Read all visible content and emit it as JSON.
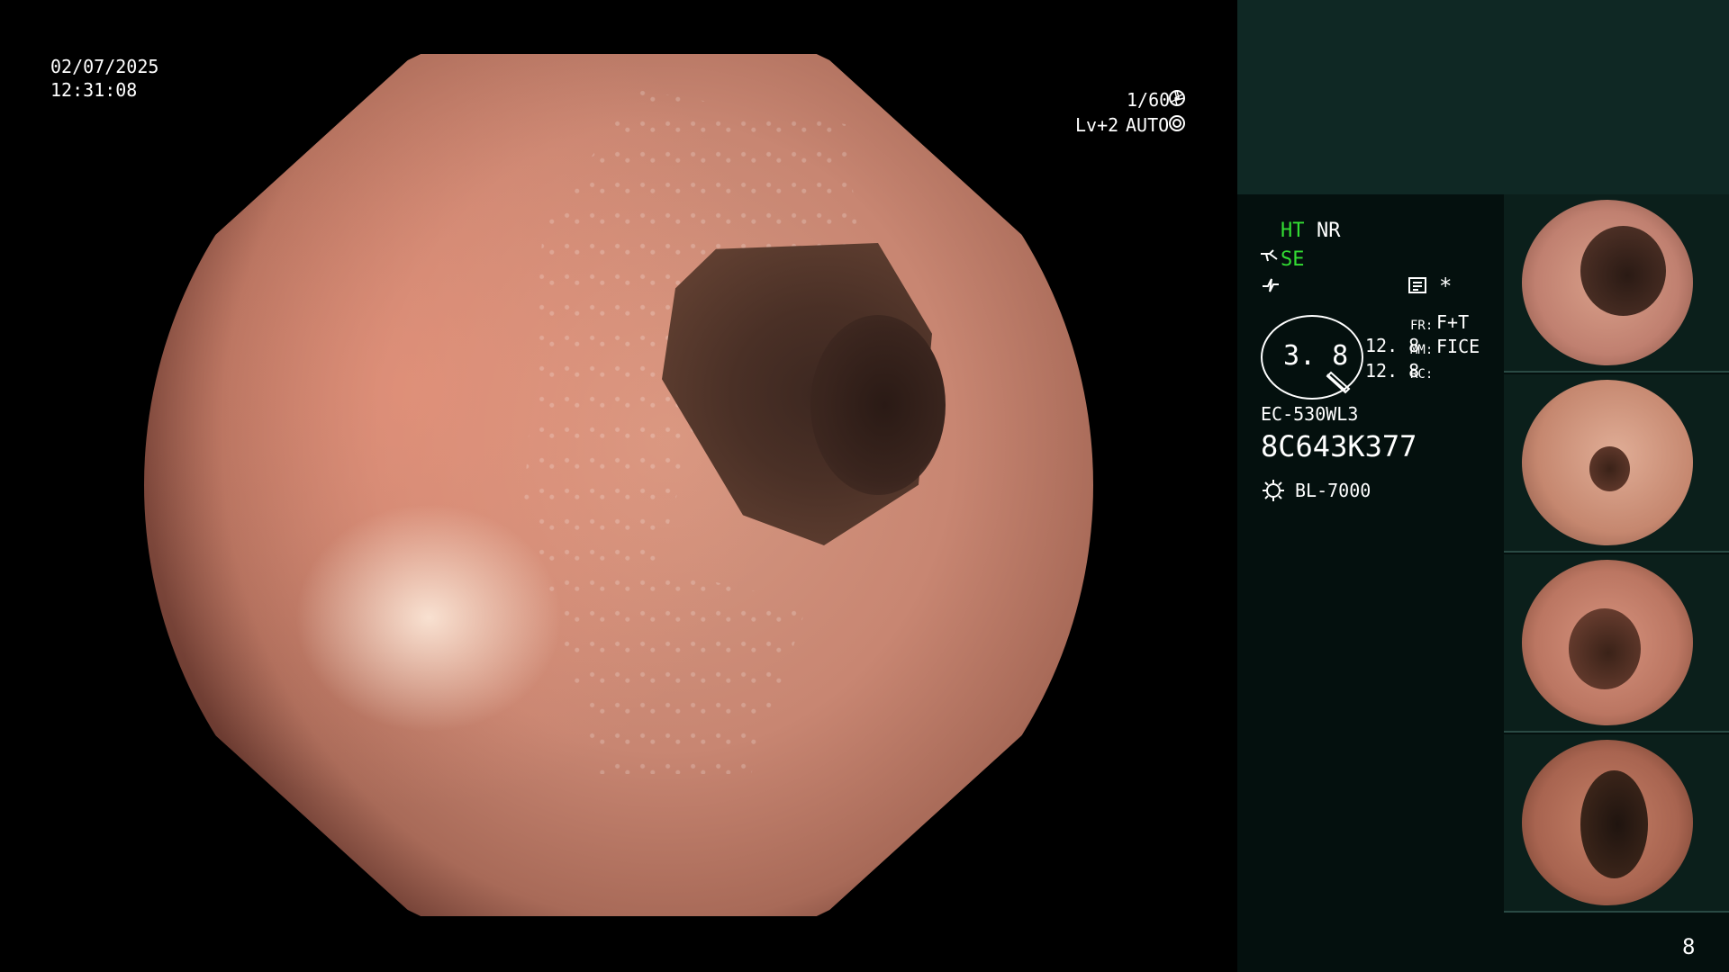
{
  "overlay": {
    "date": "02/07/2025",
    "time": "12:31:08",
    "shutter": "1/60",
    "level": "Lv+2",
    "mode": "AUTO"
  },
  "settings": {
    "ht": "HT",
    "nr": "NR",
    "se": "SE",
    "asterisk": "*",
    "zoom_value": "3. 8",
    "value_a": "12. 8",
    "value_b": "12. 8",
    "fr_label": "FR:",
    "fr_value": "F+T",
    "mm_label": "MM:",
    "mm_value": "FICE",
    "rc_label": "RC:",
    "scope_model": "EC-530WL3",
    "serial": "8C643K377",
    "light_source": "BL-7000"
  },
  "thumbnails": {
    "count": 4
  },
  "page_number": "8",
  "colors": {
    "accent_green": "#33dd33",
    "panel_bg": "#04100e",
    "panel_header": "#0f2824"
  },
  "icons": [
    "aperture-icon",
    "iris-icon",
    "scope-icon",
    "waveform-icon",
    "monitor-icon",
    "zoom-ring-icon",
    "lamp-icon"
  ]
}
